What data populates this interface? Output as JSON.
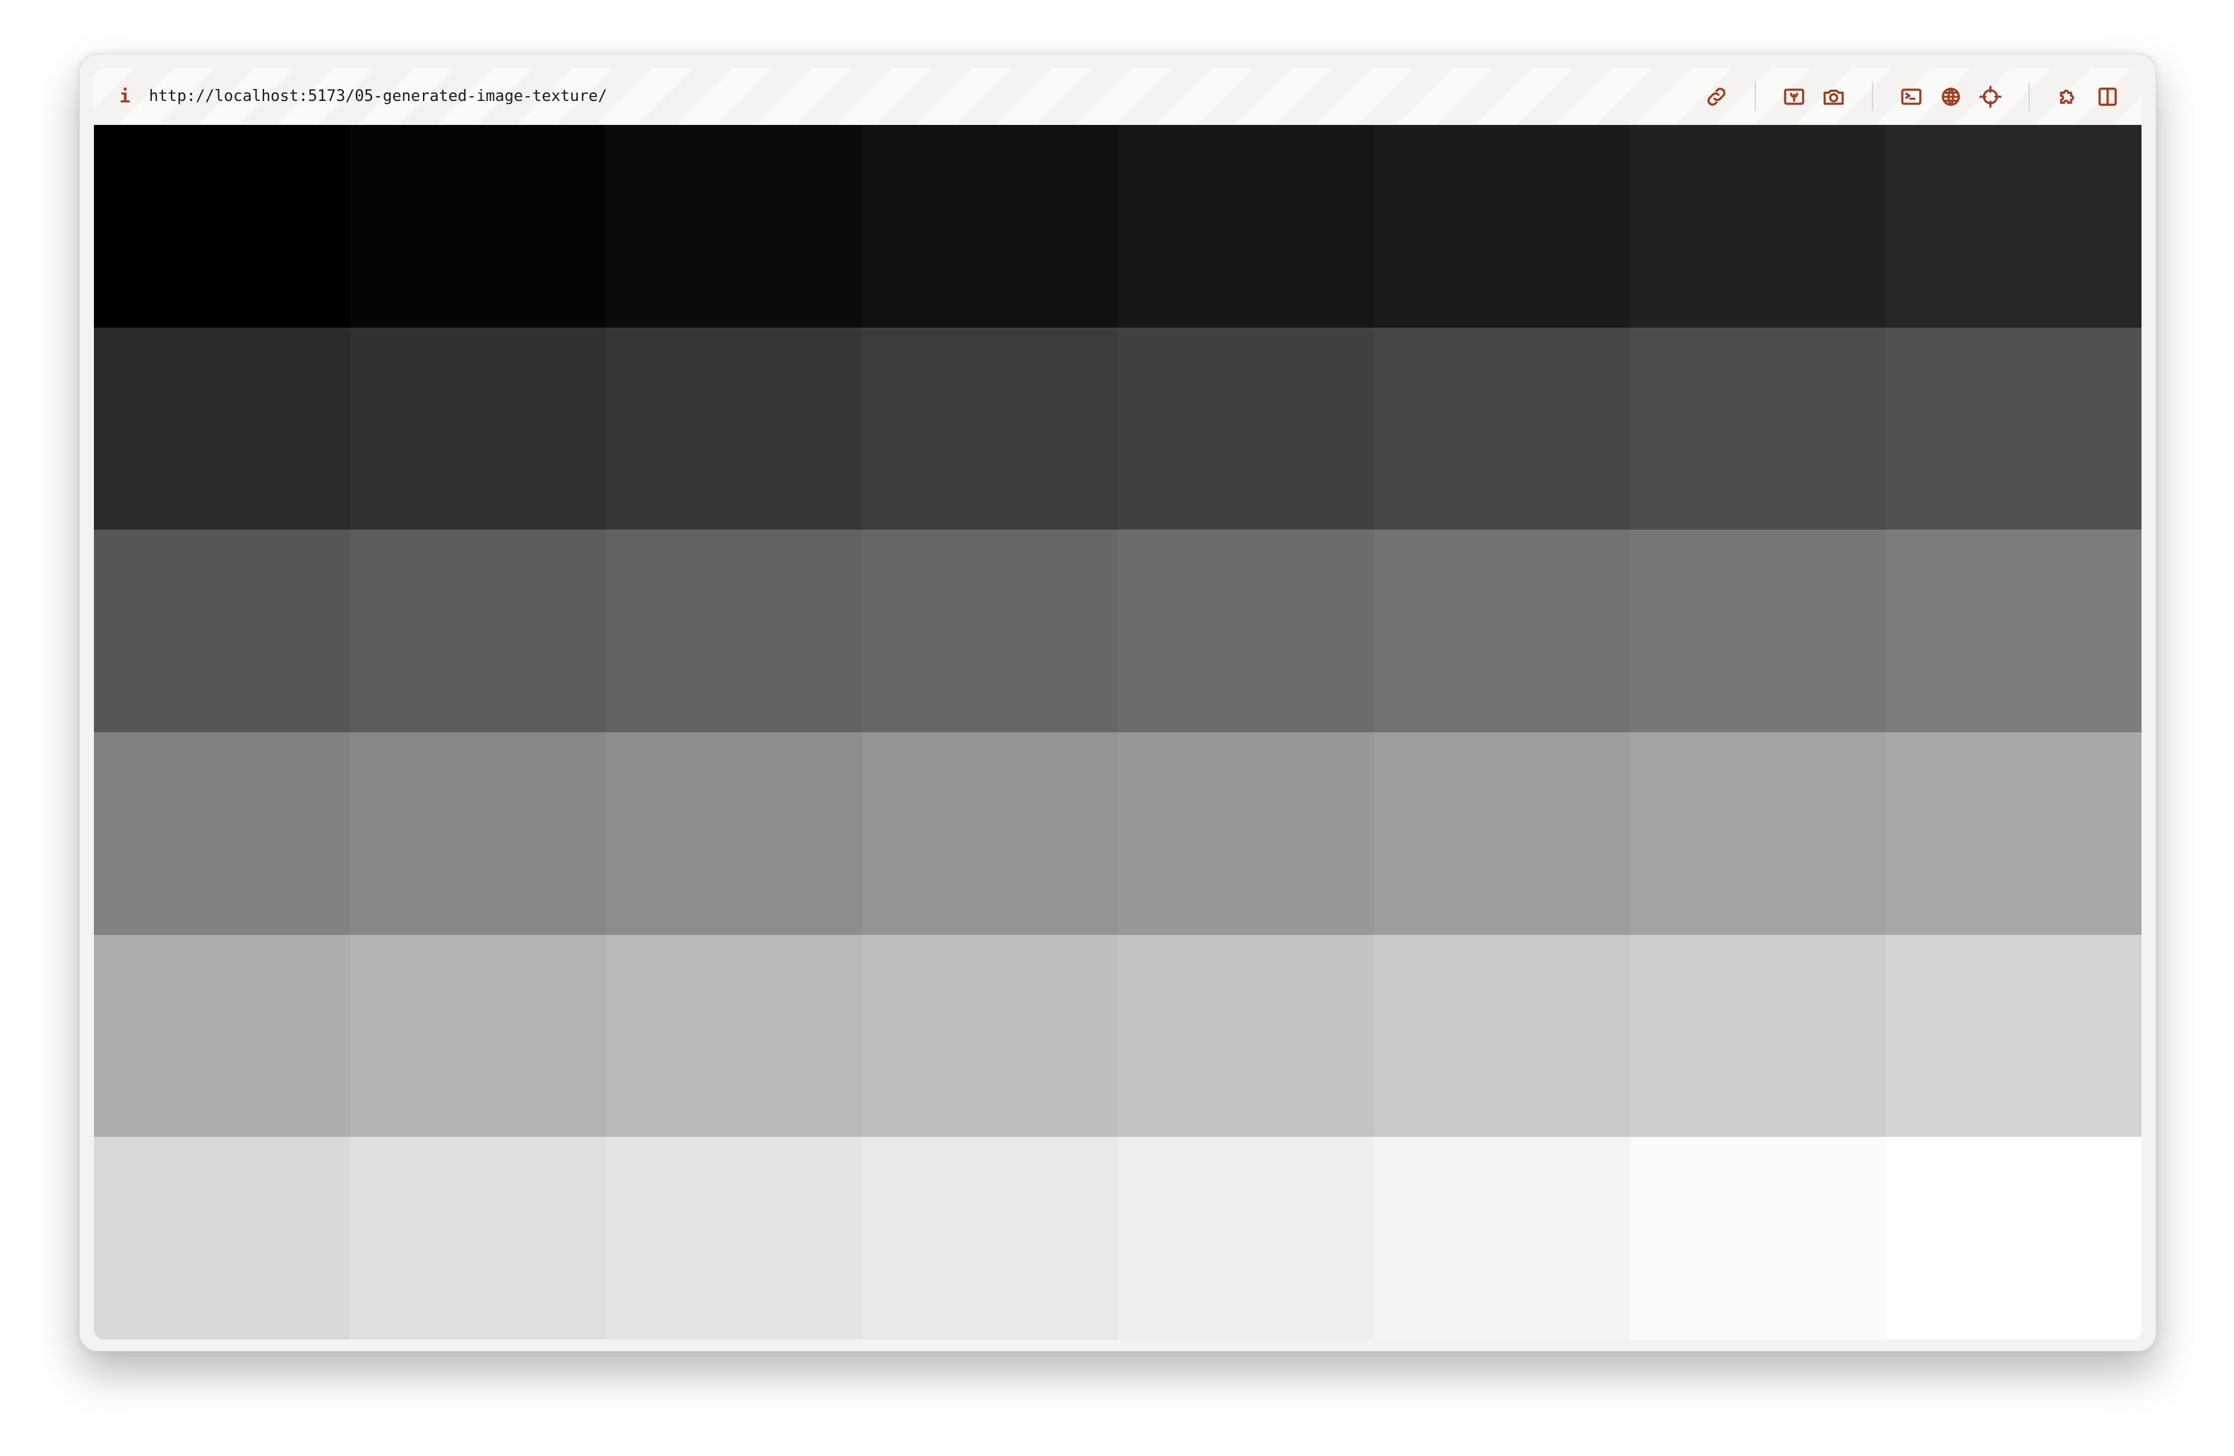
{
  "browser": {
    "info_label": "i",
    "url": "http://localhost:5173/05-generated-image-texture/",
    "icons": [
      "link-icon",
      "image-icon",
      "camera-icon",
      "terminal-icon",
      "globe-icon",
      "crosshair-icon",
      "puzzle-icon",
      "split-view-icon"
    ],
    "accent_color": "#9c3f23"
  },
  "texture": {
    "columns": 8,
    "rows": 6,
    "gray_levels": [
      0,
      5,
      11,
      16,
      22,
      27,
      33,
      38,
      43,
      49,
      54,
      60,
      65,
      71,
      76,
      81,
      87,
      92,
      98,
      103,
      109,
      114,
      119,
      125,
      130,
      136,
      141,
      147,
      152,
      157,
      163,
      168,
      174,
      179,
      185,
      190,
      195,
      201,
      206,
      212,
      217,
      223,
      228,
      233,
      239,
      244,
      250,
      255
    ]
  }
}
